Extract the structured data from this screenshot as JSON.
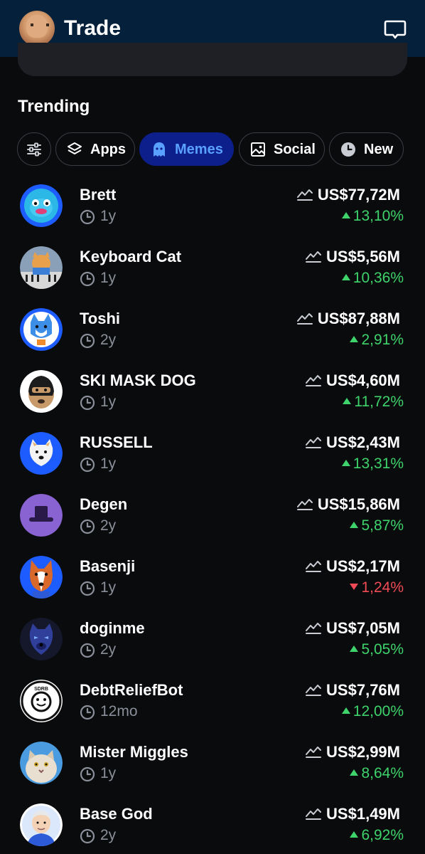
{
  "header": {
    "title": "Trade",
    "avatar_icon": "user-avatar",
    "chat_icon": "chat-bubble-icon"
  },
  "section": {
    "title": "Trending"
  },
  "filters": [
    {
      "label": "",
      "icon": "sliders-icon"
    },
    {
      "label": "Apps",
      "icon": "layers-icon"
    },
    {
      "label": "Memes",
      "icon": "ghost-icon",
      "active": true
    },
    {
      "label": "Social",
      "icon": "image-icon"
    },
    {
      "label": "New",
      "icon": "clock-icon"
    }
  ],
  "colors": {
    "header_bg": "#05203a",
    "active_chip_bg": "#0c1f8a",
    "active_chip_text": "#5aa0ff",
    "up": "#3ed36b",
    "down": "#ef4a55"
  },
  "tokens": [
    {
      "name": "Brett",
      "age": "1y",
      "mcap": "US$77,72M",
      "change": "13,10%",
      "direction": "up",
      "icon": "brett-icon"
    },
    {
      "name": "Keyboard Cat",
      "age": "1y",
      "mcap": "US$5,56M",
      "change": "10,36%",
      "direction": "up",
      "icon": "keyboard-cat-icon"
    },
    {
      "name": "Toshi",
      "age": "2y",
      "mcap": "US$87,88M",
      "change": "2,91%",
      "direction": "up",
      "icon": "toshi-icon"
    },
    {
      "name": "SKI MASK DOG",
      "age": "1y",
      "mcap": "US$4,60M",
      "change": "11,72%",
      "direction": "up",
      "icon": "ski-mask-dog-icon"
    },
    {
      "name": "RUSSELL",
      "age": "1y",
      "mcap": "US$2,43M",
      "change": "13,31%",
      "direction": "up",
      "icon": "russell-icon"
    },
    {
      "name": "Degen",
      "age": "2y",
      "mcap": "US$15,86M",
      "change": "5,87%",
      "direction": "up",
      "icon": "degen-icon"
    },
    {
      "name": "Basenji",
      "age": "1y",
      "mcap": "US$2,17M",
      "change": "1,24%",
      "direction": "down",
      "icon": "basenji-icon"
    },
    {
      "name": "doginme",
      "age": "2y",
      "mcap": "US$7,05M",
      "change": "5,05%",
      "direction": "up",
      "icon": "doginme-icon"
    },
    {
      "name": "DebtReliefBot",
      "age": "12mo",
      "mcap": "US$7,76M",
      "change": "12,00%",
      "direction": "up",
      "icon": "debt-relief-bot-icon"
    },
    {
      "name": "Mister Miggles",
      "age": "1y",
      "mcap": "US$2,99M",
      "change": "8,64%",
      "direction": "up",
      "icon": "mister-miggles-icon"
    },
    {
      "name": "Base God",
      "age": "2y",
      "mcap": "US$1,49M",
      "change": "6,92%",
      "direction": "up",
      "icon": "base-god-icon"
    }
  ]
}
